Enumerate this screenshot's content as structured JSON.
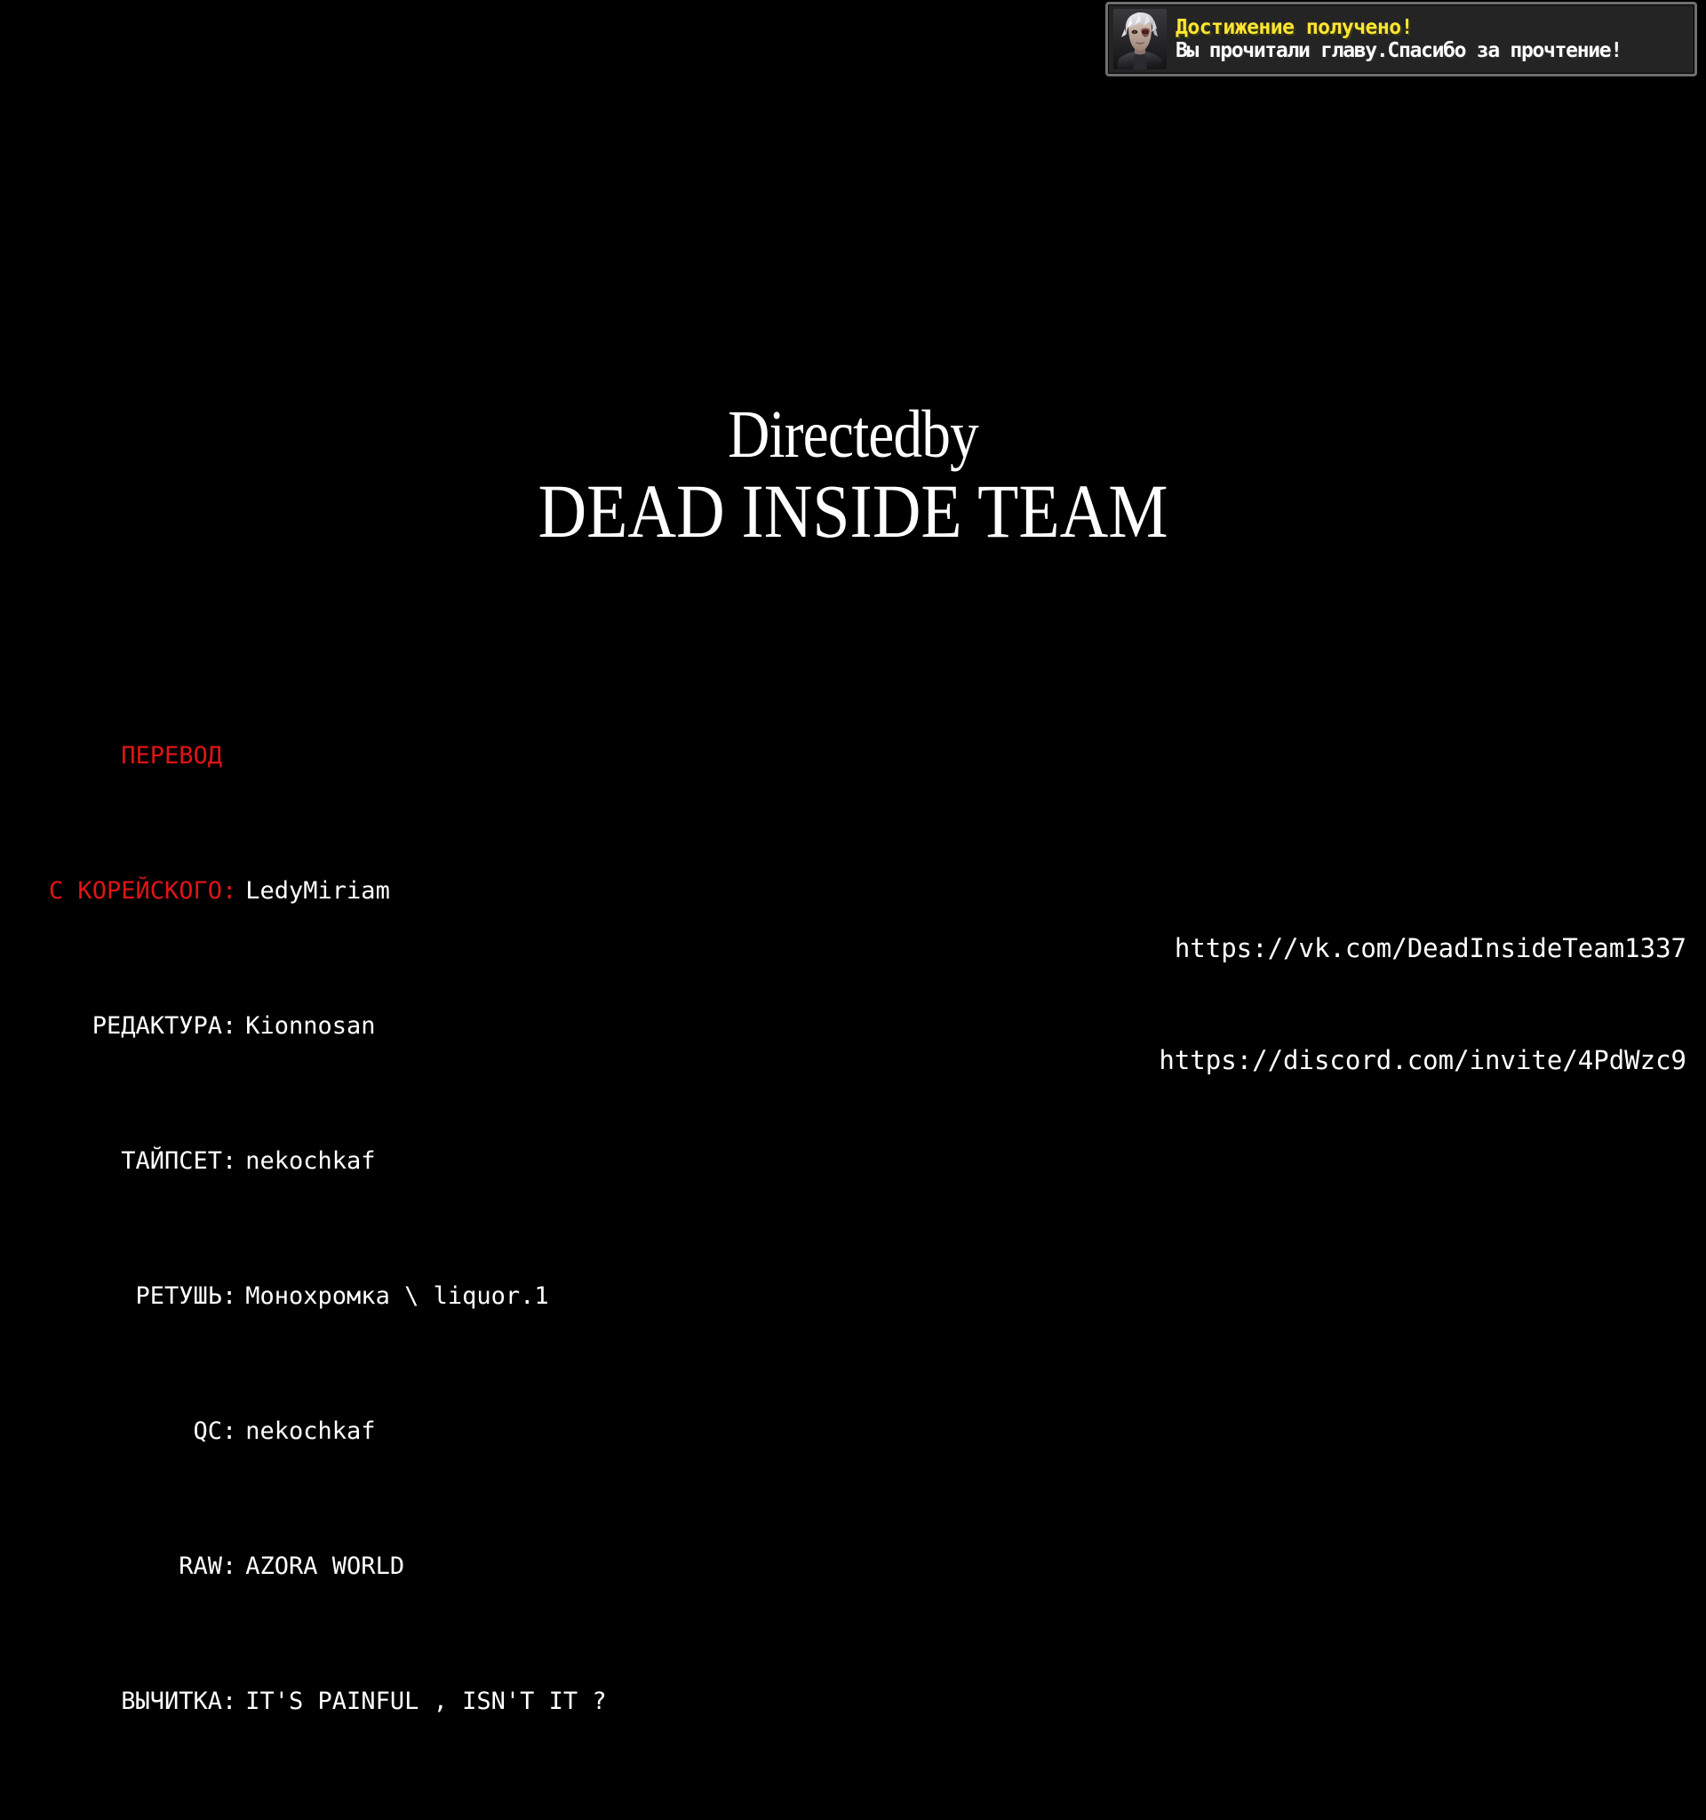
{
  "page": {
    "background_color": "#000000",
    "accent_red": "#e01414",
    "text_white": "#ffffff"
  },
  "achievement_toast": {
    "icon_name": "character-portrait-icon",
    "title": "Достижение получено!",
    "subtitle": "Вы прочитали главу.Спасибо за прочтение!",
    "title_color": "#ffe533",
    "subtitle_color": "#ffffff",
    "panel_color": "#242424",
    "border_color": "#6f6f6f"
  },
  "directed": {
    "line1": "Directedby",
    "line2": "DEAD INSIDE TEAM"
  },
  "credits": {
    "standalone_label": "ПЕРЕВОД",
    "rows": [
      {
        "label": "С КОРЕЙСКОГО",
        "sep": ":",
        "value": "LedyMiriam",
        "red": true
      },
      {
        "label": "РЕДАКТУРА",
        "sep": ":",
        "value": "Kionnosan",
        "red": false
      },
      {
        "label": "ТАЙПСЕТ",
        "sep": ":",
        "value": "nekochkaf",
        "red": false
      },
      {
        "label": "РЕТУШЬ",
        "sep": ":",
        "value": "Монохромка \\ liquor.1",
        "red": false
      },
      {
        "label": "QC",
        "sep": ":",
        "value": "nekochkaf",
        "red": false
      },
      {
        "label": "RAW",
        "sep": ":",
        "value": "AZORA WORLD",
        "red": false
      },
      {
        "label": "ВЫЧИТКА",
        "sep": ":",
        "value": "IT'S PAINFUL , ISN'T IT ?",
        "red": false
      }
    ]
  },
  "links": {
    "vk": "https://vk.com/DeadInsideTeam1337",
    "discord": "https://discord.com/invite/4PdWzc9"
  }
}
